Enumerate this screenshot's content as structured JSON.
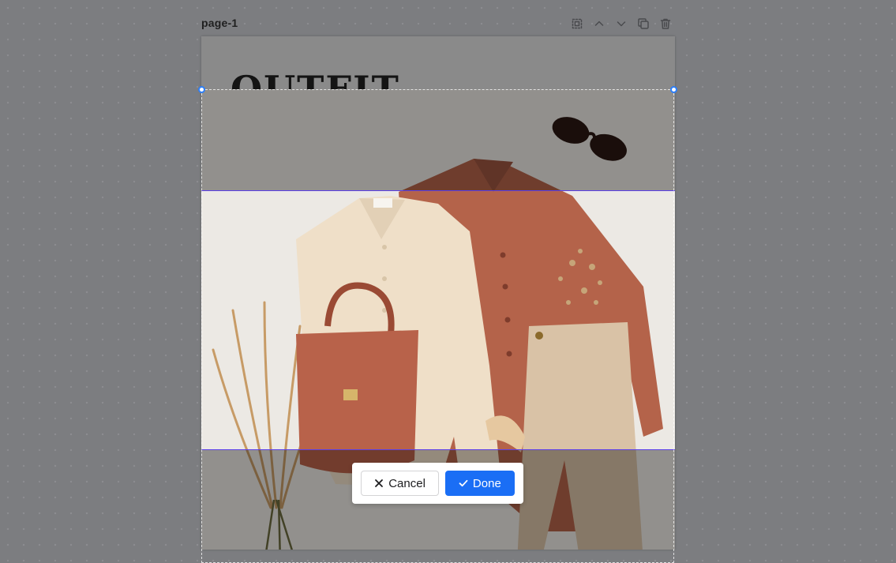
{
  "page": {
    "label": "page-1",
    "heading": "OUTFIT"
  },
  "toolbar": {
    "items": [
      {
        "icon": "ungroup-icon"
      },
      {
        "icon": "chevron-up-icon"
      },
      {
        "icon": "chevron-down-icon"
      },
      {
        "icon": "duplicate-icon"
      },
      {
        "icon": "trash-icon"
      }
    ]
  },
  "actions": {
    "cancel_label": "Cancel",
    "cancel_icon": "close-icon",
    "done_label": "Done",
    "done_icon": "check-icon"
  },
  "colors": {
    "accent": "#1a6ef5",
    "crop_outline": "#5b3fe8",
    "handle": "#2d7ff9"
  }
}
